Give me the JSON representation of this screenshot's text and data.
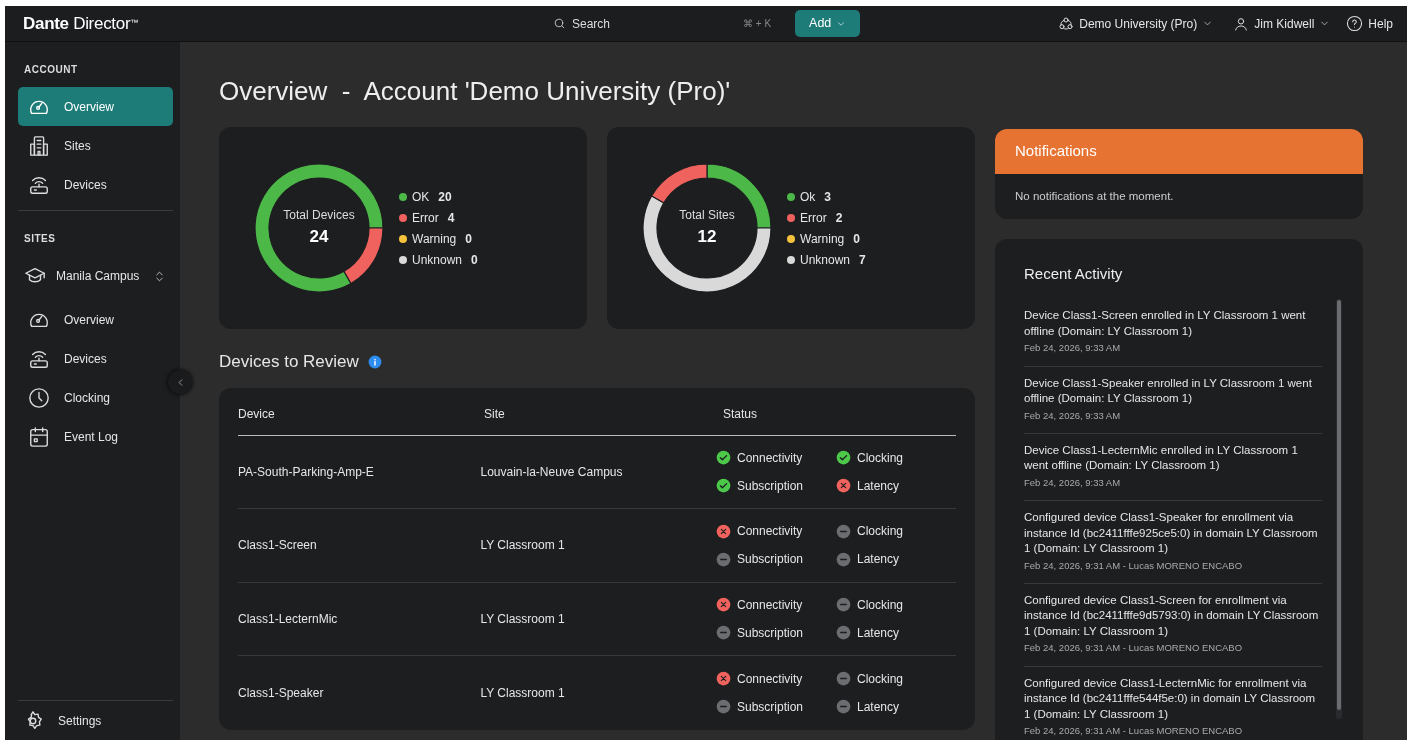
{
  "topbar": {
    "logo": "**Dante** Director$^{™}$",
    "search": {
      "label": "Search",
      "shortcut": "⌘ + K"
    },
    "add_button": "Add",
    "account": "Demo University (Pro)",
    "user": "Jim Kidwell",
    "help": "Help"
  },
  "sidebar": {
    "sections": [
      {
        "title": "ACCOUNT",
        "items": [
          {
            "label": "Overview",
            "selected": true
          },
          {
            "label": "Sites",
            "selected": false
          },
          {
            "label": "Devices",
            "selected": false
          }
        ]
      },
      {
        "title": "SITES",
        "site_picker": "Manila Campus",
        "items": [
          {
            "label": "Overview",
            "selected": false
          },
          {
            "label": "Devices",
            "selected": false
          },
          {
            "label": "Clocking",
            "selected": false
          },
          {
            "label": "Event Log",
            "selected": false
          }
        ]
      }
    ],
    "settings": "Settings"
  },
  "page_title": "Overview  -  Account 'Demo University (Pro)'",
  "summaries": [
    {
      "total": "24",
      "legend": [
        {
          "count": "20",
          "color": "#4cb848"
        },
        {
          "count": "4",
          "color": "#f0625d"
        },
        {
          "count": "0",
          "color": "#f5c23c"
        },
        {
          "count": "0",
          "color": "#d9d9d9"
        }
      ],
      "chart_data": {
        "type": "donut",
        "categories": [
          "OK",
          "Error",
          "Warning",
          "Unknown"
        ],
        "series": [
          {
            "name": "Total Devices",
            "values": [
              83.33,
              16.67,
              0,
              0
            ]
          }
        ]
      }
    },
    {
      "total": "12",
      "legend": [
        {
          "count": "3",
          "color": "#4cb848"
        },
        {
          "count": "2",
          "color": "#f0625d"
        },
        {
          "count": "0",
          "color": "#f5c23c"
        },
        {
          "count": "7",
          "color": "#d9d9d9"
        }
      ],
      "chart_data": {
        "type": "donut",
        "categories": [
          "Ok",
          "Error",
          "Warning",
          "Unknown"
        ],
        "series": [
          {
            "name": "Total Sites",
            "values": [
              25,
              16.67,
              0,
              58.33
            ]
          }
        ]
      }
    }
  ],
  "review": {
    "title": "Devices to Review",
    "columns": [
      "Device",
      "Site",
      "Status"
    ],
    "rows": [
      {
        "device": "PA-South-Parking-Amp-E",
        "site": "Louvain-la-Neuve Campus",
        "checks": [
          {
            "label": "Connectivity",
            "kind": "ok"
          },
          {
            "label": "Clocking",
            "kind": "ok"
          },
          {
            "label": "Subscription",
            "kind": "ok"
          },
          {
            "label": "Latency",
            "kind": "error"
          }
        ]
      },
      {
        "device": "Class1-Screen",
        "site": "LY Classroom 1",
        "checks": [
          {
            "label": "Connectivity",
            "kind": "error"
          },
          {
            "label": "Clocking",
            "kind": "unknown"
          },
          {
            "label": "Subscription",
            "kind": "unknown"
          },
          {
            "label": "Latency",
            "kind": "unknown"
          }
        ]
      },
      {
        "device": "Class1-LecternMic",
        "site": "LY Classroom 1",
        "checks": [
          {
            "label": "Connectivity",
            "kind": "error"
          },
          {
            "label": "Clocking",
            "kind": "unknown"
          },
          {
            "label": "Subscription",
            "kind": "unknown"
          },
          {
            "label": "Latency",
            "kind": "unknown"
          }
        ]
      },
      {
        "device": "Class1-Speaker",
        "site": "LY Classroom 1",
        "checks": [
          {
            "label": "Connectivity",
            "kind": "error"
          },
          {
            "label": "Clocking",
            "kind": "unknown"
          },
          {
            "label": "Subscription",
            "kind": "unknown"
          },
          {
            "label": "Latency",
            "kind": "unknown"
          }
        ]
      }
    ]
  },
  "notifications": {
    "title": "Notifications",
    "message": "No notifications at the moment."
  },
  "recent_activity": {
    "title": "Recent Activity",
    "items": [
      {
        "text": "Device Class1-Screen enrolled in LY Classroom 1 went offline (Domain: LY Classroom 1)",
        "meta": "Feb 24, 2026, 9:33 AM"
      },
      {
        "text": "Device Class1-Speaker enrolled in LY Classroom 1 went offline (Domain: LY Classroom 1)",
        "meta": "Feb 24, 2026, 9:33 AM"
      },
      {
        "text": "Device Class1-LecternMic enrolled in LY Classroom 1 went offline (Domain: LY Classroom 1)",
        "meta": "Feb 24, 2026, 9:33 AM"
      },
      {
        "text": "Configured device Class1-Speaker for enrollment via instance Id (bc2411fffe925ce5:0) in domain LY Classroom 1 (Domain: LY Classroom 1)",
        "meta": "Feb 24, 2026, 9:31 AM - Lucas MORENO ENCABO"
      },
      {
        "text": "Configured device Class1-Screen for enrollment via instance Id (bc2411fffe9d5793:0) in domain LY Classroom 1 (Domain: LY Classroom 1)",
        "meta": "Feb 24, 2026, 9:31 AM - Lucas MORENO ENCABO"
      },
      {
        "text": "Configured device Class1-LecternMic for enrollment via instance Id (bc2411fffe544f5e:0) in domain LY Classroom 1 (Domain: LY Classroom 1)",
        "meta": "Feb 24, 2026, 9:31 AM - Lucas MORENO ENCABO"
      }
    ]
  }
}
